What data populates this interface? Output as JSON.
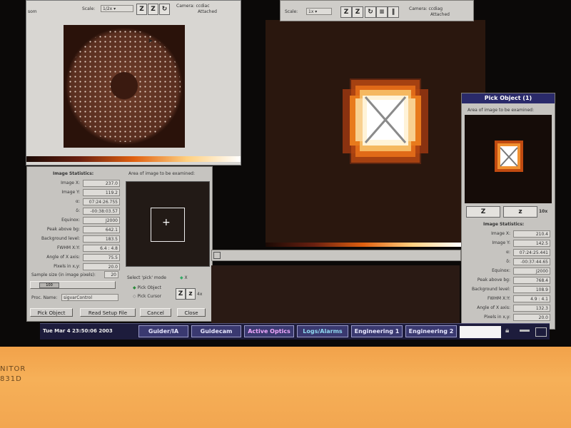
{
  "top_window_left": {
    "scale_label": "Scale:",
    "scale_value": "1/2x",
    "camera_label": "Camera: ccdiac",
    "camera_status": "Attached",
    "fragment": "som"
  },
  "top_window_right": {
    "scale_label": "Scale:",
    "scale_value": "1x",
    "camera_label": "Camera: ccdiag",
    "camera_status": "Attached"
  },
  "left_stats": {
    "title": "Image Statistics:",
    "rows": [
      {
        "label": "Image X:",
        "value": "237.0"
      },
      {
        "label": "Image Y:",
        "value": "119.2"
      },
      {
        "label": "α:",
        "value": "07:24:26.755"
      },
      {
        "label": "δ:",
        "value": "-00:38:03.57"
      },
      {
        "label": "Equinox:",
        "value": "J2000"
      },
      {
        "label": "Peak above bg:",
        "value": "642.1"
      },
      {
        "label": "Background level:",
        "value": "183.5"
      },
      {
        "label": "FWHM X:Y:",
        "value": "6.4 : 4.8"
      },
      {
        "label": "Angle of X axis:",
        "value": "75.5"
      },
      {
        "label": "Pixels in x,y:",
        "value": "20.0"
      }
    ],
    "area_title": "Area of image to be examined:",
    "sample_label": "Sample size (in image pixels):",
    "sample_value": "20",
    "slider_value": "100",
    "proc_label": "Proc. Name:",
    "proc_value": "sigvarControl",
    "mode_label": "Select 'pick' mode",
    "mode_x": "X",
    "mode_object": "Pick Object",
    "mode_cursor": "Pick Cursor",
    "zoom_value": "4x",
    "z_big": "Z",
    "z_small": "z",
    "buttons": [
      "Pick Object",
      "Read Setup File",
      "Cancel",
      "Close"
    ]
  },
  "pick_window": {
    "title": "Pick Object (1)",
    "area_title": "Area of image to be examined:",
    "zoom_in": "Z",
    "zoom_out": "z",
    "zoom_value": "10x",
    "stats_title": "Image Statistics:",
    "rows": [
      {
        "label": "Image X:",
        "value": "210.4"
      },
      {
        "label": "Image Y:",
        "value": "142.5"
      },
      {
        "label": "α:",
        "value": "07:24:25.441"
      },
      {
        "label": "δ:",
        "value": "-00:37:44.65"
      },
      {
        "label": "Equinox:",
        "value": "J2000"
      },
      {
        "label": "Peak above bg:",
        "value": "768.4"
      },
      {
        "label": "Background level:",
        "value": "108.9"
      },
      {
        "label": "FWHM X:Y:",
        "value": "4.9 : 4.1"
      },
      {
        "label": "Angle of X axis:",
        "value": "132.3"
      },
      {
        "label": "Pixels in x,y:",
        "value": "20.0"
      }
    ]
  },
  "taskbar": {
    "datetime": "Tue Mar  4 23:50:06 2003",
    "tabs": [
      "Guider/IA",
      "Guidecam",
      "Active Optics",
      "Logs/Alarms",
      "Engineering 1",
      "Engineering 2"
    ]
  },
  "monitor_label": {
    "line1": "NITOR",
    "line2": "831D"
  },
  "colors": {
    "accent_active": "#7fd3e8",
    "active_optics": "#e89aff",
    "star_hot": "#ffffff",
    "star_orange": "#e86a10"
  }
}
